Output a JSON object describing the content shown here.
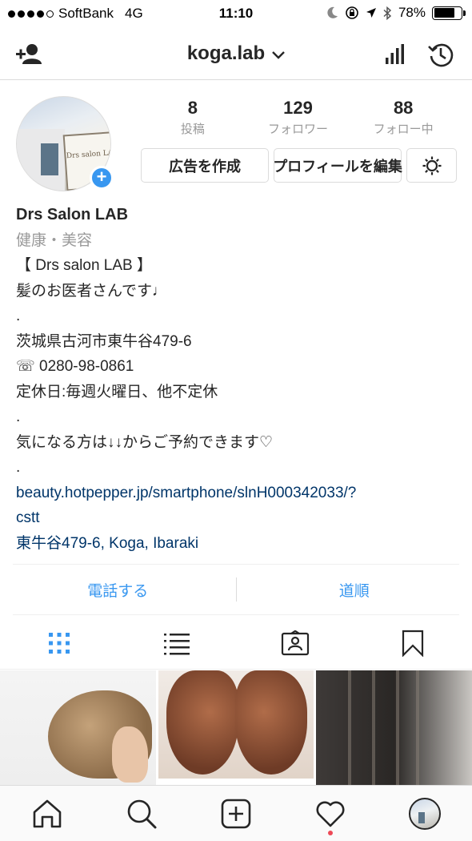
{
  "status_bar": {
    "carrier": "SoftBank",
    "network": "4G",
    "time": "11:10",
    "battery": "78%",
    "battery_level": 0.78,
    "icons": [
      "moon-icon",
      "rotation-lock-icon",
      "location-icon",
      "bluetooth-icon"
    ]
  },
  "nav": {
    "username": "koga.lab",
    "chevron": "⌄",
    "left_icon": "add-person-icon",
    "right_icons": [
      "insights-icon",
      "archive-clock-icon"
    ]
  },
  "profile": {
    "stats": [
      {
        "value": "8",
        "label": "投稿"
      },
      {
        "value": "129",
        "label": "フォロワー"
      },
      {
        "value": "88",
        "label": "フォロー中"
      }
    ],
    "buttons": {
      "create_ad": "広告を作成",
      "edit_profile": "プロフィールを編集"
    },
    "avatar_sign": "Drs salon LAB"
  },
  "bio": {
    "name": "Drs Salon LAB",
    "category": "健康・美容",
    "lines": [
      "【 Drs salon LAB 】",
      "髪のお医者さんです♩",
      ".",
      "茨城県古河市東牛谷479-6",
      "☏ 0280-98-0861",
      "定休日:毎週火曜日、他不定休",
      ".",
      "気になる方は↓↓からご予約できます♡",
      "."
    ],
    "link_line1": "beauty.hotpepper.jp/smartphone/slnH000342033/?",
    "link_line2": "cstt",
    "location": "東牛谷479-6, Koga, Ibaraki"
  },
  "actions": {
    "call": "電話する",
    "directions": "道順"
  },
  "tabs": [
    "grid-icon",
    "list-icon",
    "tagged-icon",
    "saved-icon"
  ],
  "tabbar": [
    "home-icon",
    "search-icon",
    "new-post-icon",
    "activity-heart-icon",
    "profile-avatar"
  ],
  "colors": {
    "accent": "#3897f0",
    "link": "#003569",
    "notification": "#ed4956",
    "muted": "#999999"
  }
}
